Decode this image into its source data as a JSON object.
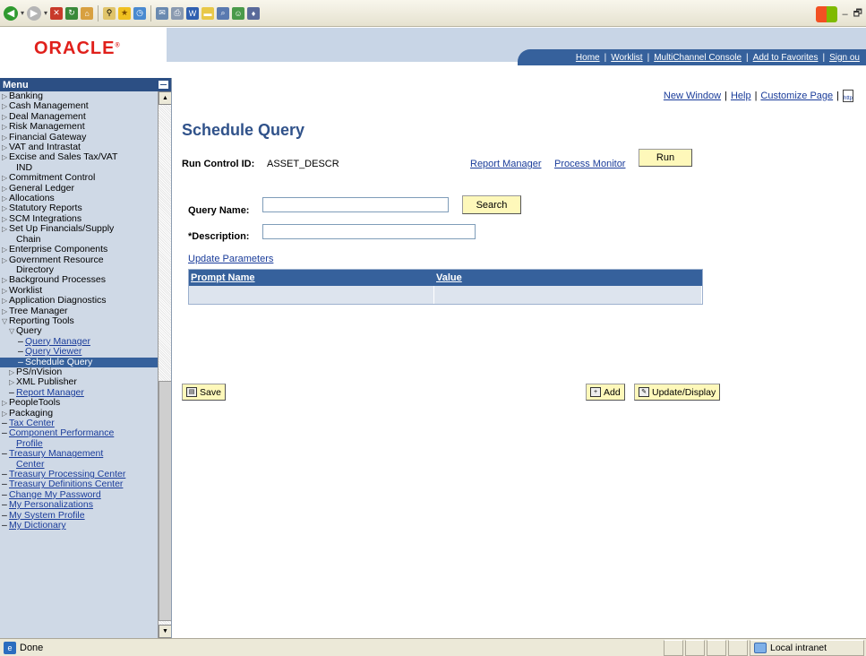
{
  "browser": {
    "toolbar_icons": [
      "back-icon",
      "forward-icon",
      "stop-icon",
      "refresh-icon",
      "home-icon",
      "search-icon",
      "favorites-icon",
      "history-icon",
      "mail-icon",
      "print-icon",
      "edit-icon",
      "folder-icon",
      "research-icon",
      "messenger-icon",
      "bluetooth-icon"
    ],
    "status_text": "Done",
    "zone_text": "Local intranet"
  },
  "header": {
    "logo": "ORACLE",
    "nav_links": [
      "Home",
      "Worklist",
      "MultiChannel Console",
      "Add to Favorites",
      "Sign ou"
    ]
  },
  "menu": {
    "title": "Menu",
    "items": [
      {
        "label": "Banking",
        "type": "folder"
      },
      {
        "label": "Cash Management",
        "type": "folder"
      },
      {
        "label": "Deal Management",
        "type": "folder"
      },
      {
        "label": "Risk Management",
        "type": "folder"
      },
      {
        "label": "Financial Gateway",
        "type": "folder"
      },
      {
        "label": "VAT and Intrastat",
        "type": "folder"
      },
      {
        "label": "Excise and Sales Tax/VAT",
        "type": "folder"
      },
      {
        "label": "IND",
        "type": "cont"
      },
      {
        "label": "Commitment Control",
        "type": "folder"
      },
      {
        "label": "General Ledger",
        "type": "folder"
      },
      {
        "label": "Allocations",
        "type": "folder"
      },
      {
        "label": "Statutory Reports",
        "type": "folder"
      },
      {
        "label": "SCM Integrations",
        "type": "folder"
      },
      {
        "label": "Set Up Financials/Supply",
        "type": "folder"
      },
      {
        "label": "Chain",
        "type": "cont"
      },
      {
        "label": "Enterprise Components",
        "type": "folder"
      },
      {
        "label": "Government Resource",
        "type": "folder"
      },
      {
        "label": "Directory",
        "type": "cont"
      },
      {
        "label": "Background Processes",
        "type": "folder"
      },
      {
        "label": "Worklist",
        "type": "folder"
      },
      {
        "label": "Application Diagnostics",
        "type": "folder"
      },
      {
        "label": "Tree Manager",
        "type": "folder"
      },
      {
        "label": "Reporting Tools",
        "type": "open"
      },
      {
        "label": "Query",
        "type": "sub-open"
      },
      {
        "label": "Query Manager",
        "type": "sub2-link"
      },
      {
        "label": "Query Viewer",
        "type": "sub2-link"
      },
      {
        "label": "Schedule Query",
        "type": "sub2-selected"
      },
      {
        "label": "PS/nVision",
        "type": "sub-folder"
      },
      {
        "label": "XML Publisher",
        "type": "sub-folder"
      },
      {
        "label": "Report Manager",
        "type": "sub-link"
      },
      {
        "label": "PeopleTools",
        "type": "folder"
      },
      {
        "label": "Packaging",
        "type": "folder"
      },
      {
        "label": "Tax Center",
        "type": "link"
      },
      {
        "label": "Component Performance",
        "type": "link"
      },
      {
        "label": "Profile",
        "type": "link-cont"
      },
      {
        "label": "Treasury Management",
        "type": "link"
      },
      {
        "label": "Center",
        "type": "link-cont"
      },
      {
        "label": "Treasury Processing Center",
        "type": "link"
      },
      {
        "label": "Treasury Definitions Center",
        "type": "link"
      },
      {
        "label": "Change My Password",
        "type": "link"
      },
      {
        "label": "My Personalizations",
        "type": "link"
      },
      {
        "label": "My System Profile",
        "type": "link"
      },
      {
        "label": "My Dictionary",
        "type": "link"
      }
    ]
  },
  "page": {
    "top_links": [
      "New Window",
      "Help",
      "Customize Page"
    ],
    "title": "Schedule Query",
    "run_control_label": "Run Control ID:",
    "run_control_value": "ASSET_DESCR",
    "report_manager_link": "Report Manager",
    "process_monitor_link": "Process Monitor",
    "run_button": "Run",
    "query_name_label": "Query Name:",
    "query_name_value": "",
    "search_button": "Search",
    "description_label": "*Description:",
    "description_value": "",
    "update_parameters_link": "Update Parameters",
    "grid_columns": [
      "Prompt Name",
      "Value"
    ],
    "save_button": "Save",
    "add_button": "Add",
    "update_display_button": "Update/Display"
  }
}
